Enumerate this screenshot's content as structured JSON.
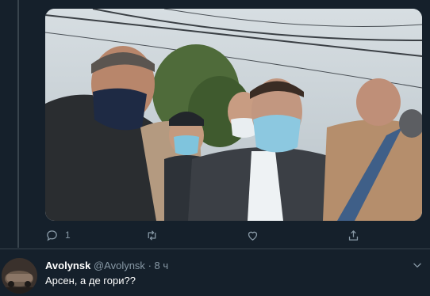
{
  "tweet": {
    "reply_count": "1",
    "retweet_count": "",
    "like_count": ""
  },
  "reply": {
    "name": "Avolynsk",
    "handle": "@Avolynsk",
    "separator": "·",
    "time": "8 ч",
    "text": "Арсен, а де гори??"
  },
  "colors": {
    "background": "#15202b",
    "secondary_text": "#8899a6",
    "border": "#38444d"
  },
  "icons": {
    "reply": "reply-icon",
    "retweet": "retweet-icon",
    "like": "heart-icon",
    "share": "share-icon",
    "more": "chevron-down-icon"
  }
}
